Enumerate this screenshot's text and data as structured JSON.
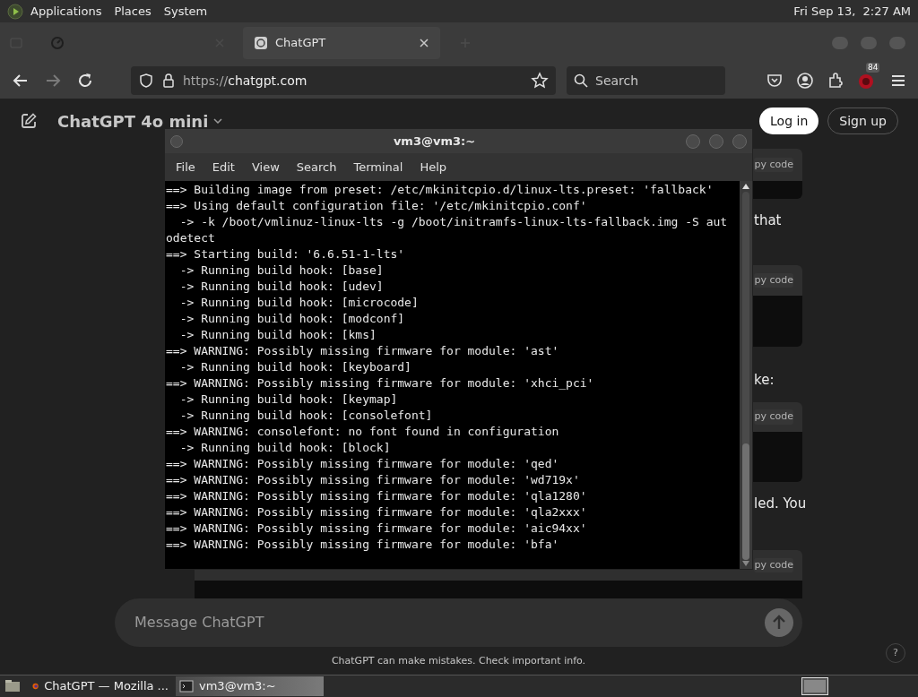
{
  "top_panel": {
    "menus": [
      "Applications",
      "Places",
      "System"
    ],
    "clock": "Fri Sep 13,  2:27 AM"
  },
  "browser": {
    "tabs": [
      {
        "selected": false
      },
      {
        "label": "ChatGPT",
        "selected": true
      }
    ],
    "address": {
      "scheme": "https://",
      "host": "chatgpt.com"
    },
    "search_placeholder": "Search",
    "extension_badge": "84"
  },
  "chat": {
    "model": "ChatGPT 4o mini",
    "login": "Log in",
    "signup": "Sign up",
    "content": [
      {
        "kind": "code",
        "header": "py code"
      },
      {
        "kind": "text",
        "text": "that"
      },
      {
        "kind": "code",
        "header": "py code"
      },
      {
        "kind": "text",
        "text": "ke:"
      },
      {
        "kind": "code",
        "header": "py code"
      },
      {
        "kind": "text",
        "text": "led. You"
      },
      {
        "kind": "code",
        "header": "py code"
      }
    ],
    "input_placeholder": "Message ChatGPT",
    "disclaimer": "ChatGPT can make mistakes. Check important info.",
    "help": "?"
  },
  "terminal": {
    "title": "vm3@vm3:~",
    "menu": [
      "File",
      "Edit",
      "View",
      "Search",
      "Terminal",
      "Help"
    ],
    "lines": [
      "==> Building image from preset: /etc/mkinitcpio.d/linux-lts.preset: 'fallback'",
      "==> Using default configuration file: '/etc/mkinitcpio.conf'",
      "  -> -k /boot/vmlinuz-linux-lts -g /boot/initramfs-linux-lts-fallback.img -S aut",
      "odetect",
      "==> Starting build: '6.6.51-1-lts'",
      "  -> Running build hook: [base]",
      "  -> Running build hook: [udev]",
      "  -> Running build hook: [microcode]",
      "  -> Running build hook: [modconf]",
      "  -> Running build hook: [kms]",
      "==> WARNING: Possibly missing firmware for module: 'ast'",
      "  -> Running build hook: [keyboard]",
      "==> WARNING: Possibly missing firmware for module: 'xhci_pci'",
      "  -> Running build hook: [keymap]",
      "  -> Running build hook: [consolefont]",
      "==> WARNING: consolefont: no font found in configuration",
      "  -> Running build hook: [block]",
      "==> WARNING: Possibly missing firmware for module: 'qed'",
      "==> WARNING: Possibly missing firmware for module: 'wd719x'",
      "==> WARNING: Possibly missing firmware for module: 'qla1280'",
      "==> WARNING: Possibly missing firmware for module: 'qla2xxx'",
      "==> WARNING: Possibly missing firmware for module: 'aic94xx'",
      "==> WARNING: Possibly missing firmware for module: 'bfa'"
    ]
  },
  "taskbar": {
    "items": [
      {
        "kind": "browser",
        "label": "ChatGPT — Mozilla ...",
        "selected": false
      },
      {
        "kind": "terminal",
        "label": "vm3@vm3:~",
        "selected": true
      }
    ]
  }
}
